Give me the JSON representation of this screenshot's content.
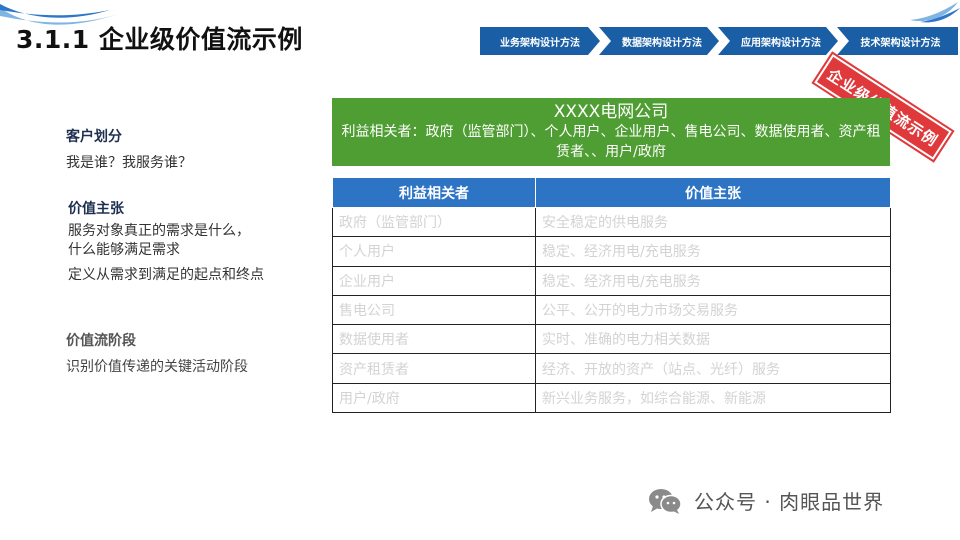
{
  "colors": {
    "title": "#111111",
    "chevron": "#1a5fa6",
    "company_box": "#4f9e33",
    "table_header": "#2e74c5",
    "stamp": "#e0393b",
    "faded_cell_text": "#d3d3d3"
  },
  "title": "3.1.1 企业级价值流示例",
  "nav": {
    "steps": [
      {
        "label": "业务架构设计方法"
      },
      {
        "label": "数据架构设计方法"
      },
      {
        "label": "应用架构设计方法"
      },
      {
        "label": "技术架构设计方法"
      }
    ]
  },
  "stamp": "企业级价值流示例",
  "left": {
    "customer_heading": "客户划分",
    "customer_text": "我是谁？我服务谁？",
    "value_heading": "价值主张",
    "value_text_1a": "服务对象真正的需求是什么，",
    "value_text_1b": "什么能够满足需求",
    "value_text_2": "定义从需求到满足的起点和终点",
    "stage_heading": "价值流阶段",
    "stage_text": "识别价值传递的关键活动阶段"
  },
  "company": {
    "name": "XXXX电网公司",
    "stakeholders": "利益相关者：政府（监管部门）、个人用户、企业用户、售电公司、数据使用者、资产租赁者、、用户/政府"
  },
  "table": {
    "headers": [
      "利益相关者",
      "价值主张"
    ],
    "rows": [
      [
        "政府（监管部门）",
        "安全稳定的供电服务"
      ],
      [
        "个人用户",
        "稳定、经济用电/充电服务"
      ],
      [
        "企业用户",
        "稳定、经济用电/充电服务"
      ],
      [
        "售电公司",
        "公平、公开的电力市场交易服务"
      ],
      [
        "数据使用者",
        "实时、准确的电力相关数据"
      ],
      [
        "资产租赁者",
        "经济、开放的资产（站点、光纤）服务"
      ],
      [
        "用户/政府",
        "新兴业务服务，如综合能源、新能源"
      ]
    ]
  },
  "watermark": {
    "icon": "wechat-icon",
    "text": "公众号 · 肉眼品世界"
  }
}
